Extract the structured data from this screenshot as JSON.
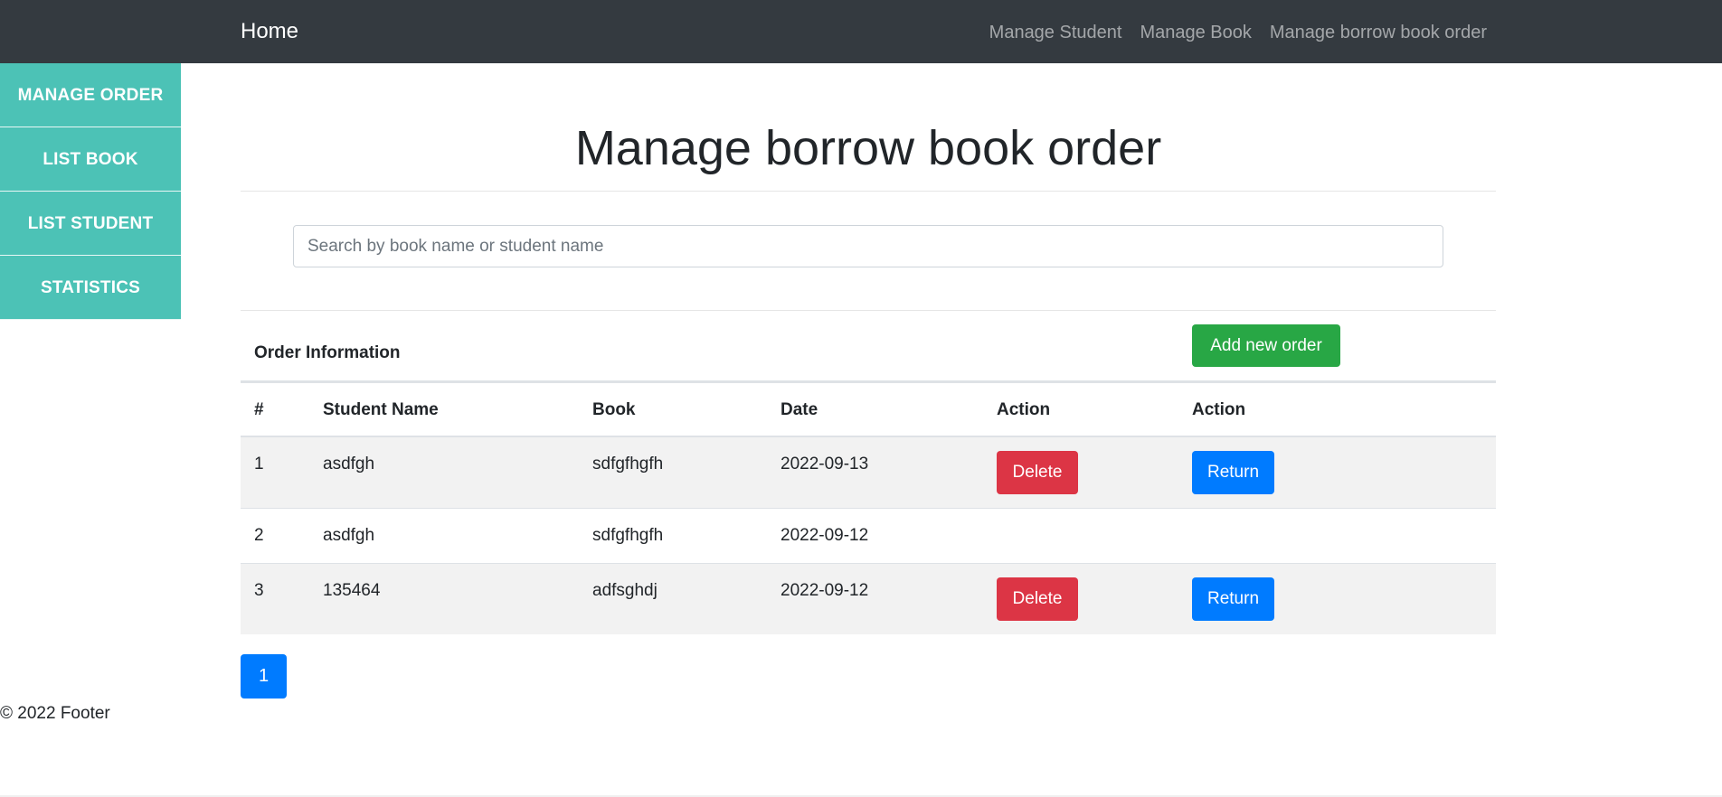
{
  "navbar": {
    "brand": "Home",
    "links": [
      "Manage Student",
      "Manage Book",
      "Manage borrow book order"
    ]
  },
  "sidebar": {
    "items": [
      "MANAGE ORDER",
      "LIST BOOK",
      "LIST STUDENT",
      "STATISTICS"
    ]
  },
  "main": {
    "title": "Manage borrow book order",
    "search_placeholder": "Search by book name or student name",
    "search_value": "",
    "section_title": "Order Information",
    "add_button": "Add new order"
  },
  "table": {
    "headers": [
      "#",
      "Student Name",
      "Book",
      "Date",
      "Action",
      "Action"
    ],
    "rows": [
      {
        "no": "1",
        "student": "asdfgh",
        "book": "sdfgfhgfh",
        "date": "2022-09-13",
        "delete": "Delete",
        "return": "Return"
      },
      {
        "no": "2",
        "student": "asdfgh",
        "book": "sdfgfhgfh",
        "date": "2022-09-12"
      },
      {
        "no": "3",
        "student": "135464",
        "book": "adfsghdj",
        "date": "2022-09-12",
        "delete": "Delete",
        "return": "Return"
      }
    ]
  },
  "pagination": {
    "current": "1"
  },
  "footer": {
    "text": "© 2022 Footer"
  },
  "colors": {
    "navbar": "#343a40",
    "sidebar": "#4cc2b6",
    "add": "#28a745",
    "delete": "#dc3545",
    "return": "#007bff"
  }
}
